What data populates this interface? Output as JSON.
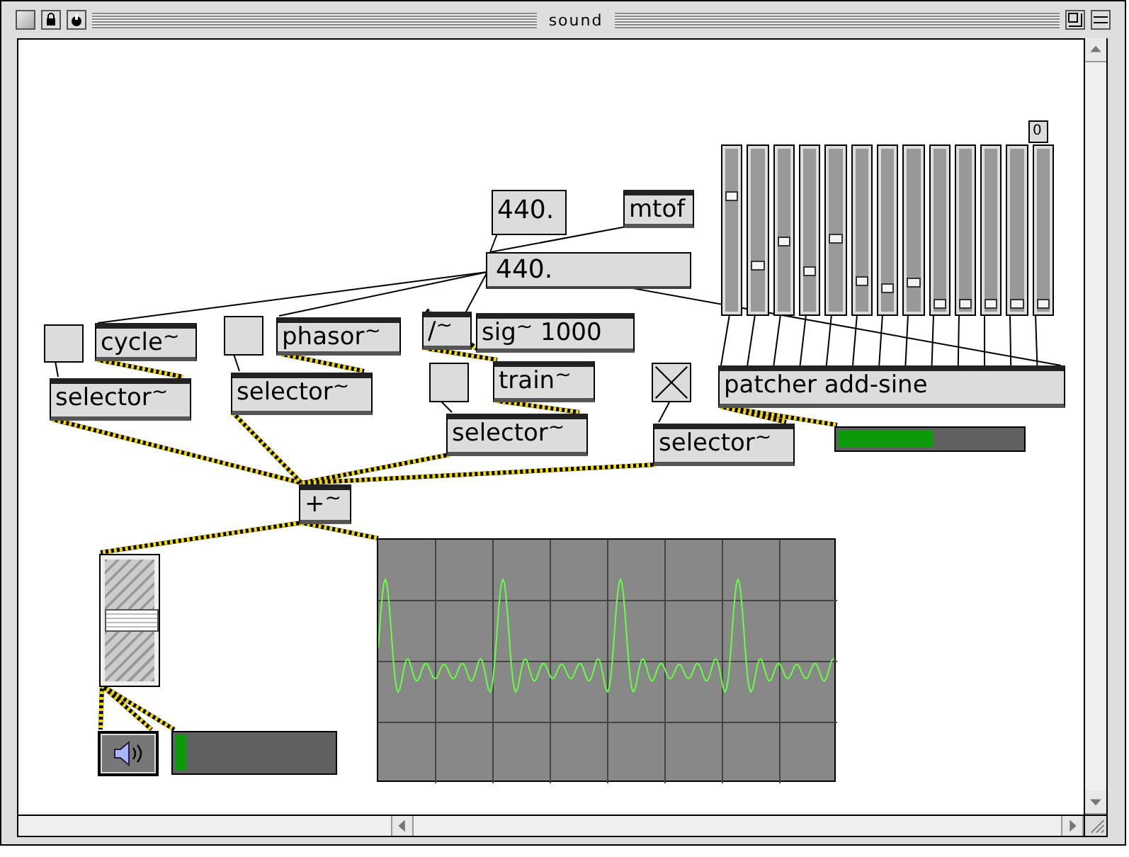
{
  "window": {
    "title": "sound"
  },
  "objects": [
    {
      "kind": "number",
      "text": "440."
    },
    {
      "kind": "object",
      "text": "mtof"
    },
    {
      "kind": "flonum",
      "text": "440."
    },
    {
      "kind": "toggle",
      "checked": false
    },
    {
      "kind": "object",
      "text": "cycle$^{~}$"
    },
    {
      "kind": "toggle",
      "checked": false
    },
    {
      "kind": "object",
      "text": "phasor$^{~}$"
    },
    {
      "kind": "object",
      "text": "/$^{~}$"
    },
    {
      "kind": "object",
      "text": "sig$^{~}$ 1000"
    },
    {
      "kind": "toggle",
      "checked": false
    },
    {
      "kind": "object",
      "text": "train$^{~}$"
    },
    {
      "kind": "object",
      "text": "selector$^{~}$"
    },
    {
      "kind": "object",
      "text": "selector$^{~}$"
    },
    {
      "kind": "object",
      "text": "selector$^{~}$"
    },
    {
      "kind": "toggle",
      "checked": true
    },
    {
      "kind": "object",
      "text": "selector$^{~}$"
    },
    {
      "kind": "multislider",
      "sliders": [
        {
          "level": 0.71
        },
        {
          "level": 0.28
        },
        {
          "level": 0.43
        },
        {
          "level": 0.24
        },
        {
          "level": 0.45
        },
        {
          "level": 0.18
        },
        {
          "level": 0.13
        },
        {
          "level": 0.17
        },
        {
          "level": 0.04
        },
        {
          "level": 0.04
        },
        {
          "level": 0.04
        },
        {
          "level": 0.04
        },
        {
          "level": 0.04
        }
      ]
    },
    {
      "kind": "smallnumber",
      "text": "0"
    },
    {
      "kind": "object",
      "text": "patcher add-sine"
    },
    {
      "kind": "meter",
      "level": 0.52
    },
    {
      "kind": "object",
      "text": "+$^{~}$"
    },
    {
      "kind": "gain",
      "level": 0.5
    },
    {
      "kind": "speaker"
    },
    {
      "kind": "meter",
      "level": 0.07
    },
    {
      "kind": "scope"
    }
  ]
}
